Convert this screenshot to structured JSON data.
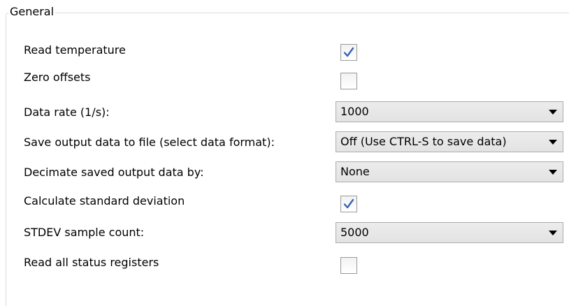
{
  "group": {
    "title": "General"
  },
  "settings": {
    "read_temperature": {
      "label": "Read temperature",
      "checked": true
    },
    "zero_offsets": {
      "label": "Zero offsets",
      "checked": false
    },
    "data_rate": {
      "label": "Data rate (1/s):",
      "value": "1000"
    },
    "save_output": {
      "label": "Save output data to file (select data format):",
      "value": "Off (Use CTRL-S to save data)"
    },
    "decimate": {
      "label": "Decimate saved output data by:",
      "value": "None"
    },
    "calc_stdev": {
      "label": "Calculate standard deviation",
      "checked": true
    },
    "stdev_count": {
      "label": "STDEV sample count:",
      "value": "5000"
    },
    "read_status": {
      "label": "Read all status registers",
      "checked": false
    }
  },
  "colors": {
    "checkmark": "#3a62b5",
    "frame": "#dcdcdc",
    "dropdown_border": "#acacac"
  },
  "icons": {
    "checkmark": "check-icon",
    "dropdown_arrow": "chevron-down-icon"
  }
}
